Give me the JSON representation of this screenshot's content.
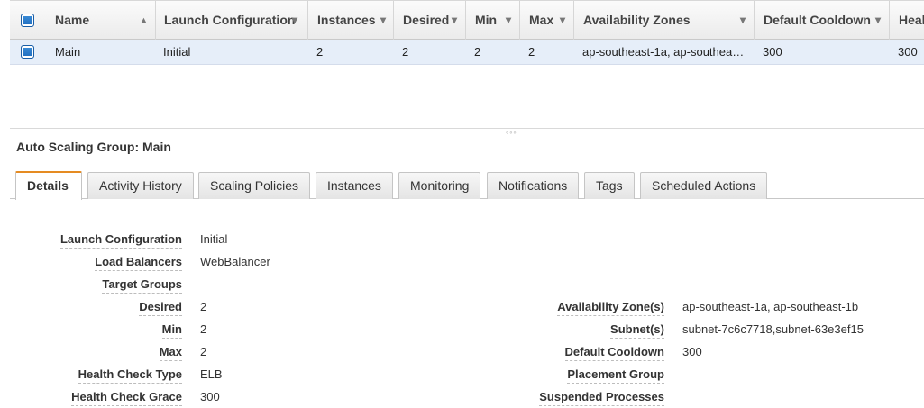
{
  "grid": {
    "columns": [
      {
        "label": "Name",
        "sort": "▲"
      },
      {
        "label": "Launch Configuration",
        "sort": "▾"
      },
      {
        "label": "Instances",
        "sort": "▾"
      },
      {
        "label": "Desired",
        "sort": "▾"
      },
      {
        "label": "Min",
        "sort": "▾"
      },
      {
        "label": "Max",
        "sort": "▾"
      },
      {
        "label": "Availability Zones",
        "sort": "▾"
      },
      {
        "label": "Default Cooldown",
        "sort": "▾"
      },
      {
        "label": "Heal",
        "sort": ""
      }
    ],
    "rows": [
      {
        "name": "Main",
        "launch_configuration": "Initial",
        "instances": "2",
        "desired": "2",
        "min": "2",
        "max": "2",
        "availability_zones": "ap-southeast-1a, ap-southea…",
        "default_cooldown": "300",
        "health": "300"
      }
    ]
  },
  "splitter_grip": "◦◦◦",
  "panel": {
    "title": "Auto Scaling Group: Main",
    "tabs": [
      "Details",
      "Activity History",
      "Scaling Policies",
      "Instances",
      "Monitoring",
      "Notifications",
      "Tags",
      "Scheduled Actions"
    ],
    "active_tab": "Details"
  },
  "details": {
    "left": [
      {
        "label": "Launch Configuration",
        "value": "Initial"
      },
      {
        "label": "Load Balancers",
        "value": "WebBalancer"
      },
      {
        "label": "Target Groups",
        "value": ""
      },
      {
        "label": "Desired",
        "value": "2"
      },
      {
        "label": "Min",
        "value": "2"
      },
      {
        "label": "Max",
        "value": "2"
      },
      {
        "label": "Health Check Type",
        "value": "ELB"
      },
      {
        "label": "Health Check Grace",
        "value": "300"
      }
    ],
    "right": [
      {
        "label": "Availability Zone(s)",
        "value": "ap-southeast-1a, ap-southeast-1b"
      },
      {
        "label": "Subnet(s)",
        "value": "subnet-7c6c7718,subnet-63e3ef15"
      },
      {
        "label": "Default Cooldown",
        "value": "300"
      },
      {
        "label": "Placement Group",
        "value": ""
      },
      {
        "label": "Suspended Processes",
        "value": ""
      }
    ]
  },
  "colors": {
    "accent_tab": "#e58b22",
    "selected_row": "#e6eef9",
    "checkbox": "#1e6bbd"
  }
}
